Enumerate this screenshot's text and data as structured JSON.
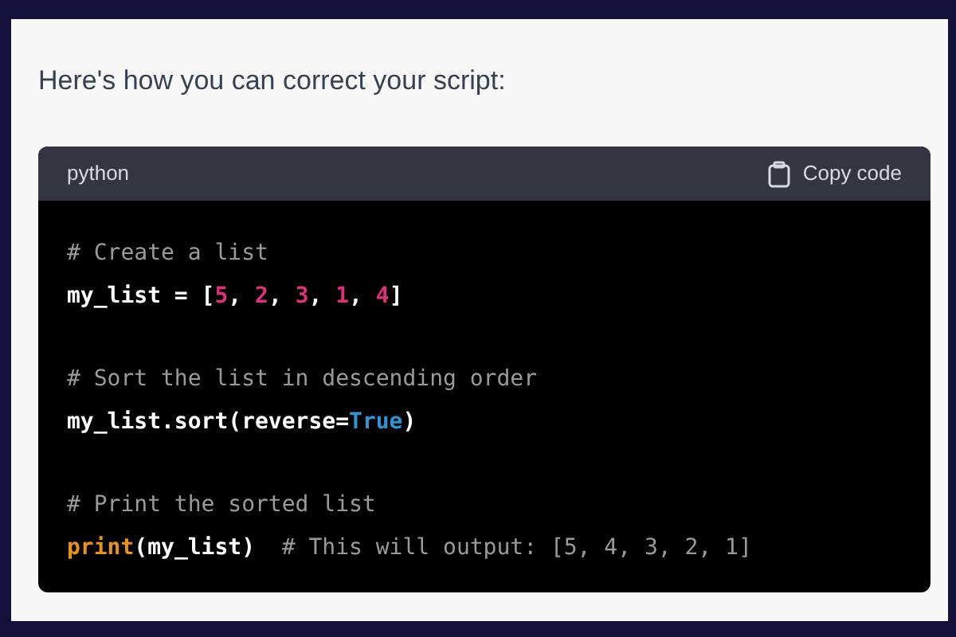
{
  "message": {
    "text": "Here's how you can correct your script:"
  },
  "code_block": {
    "language": "python",
    "copy_label": "Copy code",
    "blocks": [
      {
        "lines": [
          {
            "tokens": [
              {
                "text": "# Create a list",
                "kind": "comment"
              }
            ]
          },
          {
            "tokens": [
              {
                "text": "my_list = [",
                "kind": "plain"
              },
              {
                "text": "5",
                "kind": "number"
              },
              {
                "text": ", ",
                "kind": "plain"
              },
              {
                "text": "2",
                "kind": "number"
              },
              {
                "text": ", ",
                "kind": "plain"
              },
              {
                "text": "3",
                "kind": "number"
              },
              {
                "text": ", ",
                "kind": "plain"
              },
              {
                "text": "1",
                "kind": "number"
              },
              {
                "text": ", ",
                "kind": "plain"
              },
              {
                "text": "4",
                "kind": "number"
              },
              {
                "text": "]",
                "kind": "plain"
              }
            ]
          }
        ]
      },
      {
        "lines": [
          {
            "tokens": [
              {
                "text": "# Sort the list in descending order",
                "kind": "comment"
              }
            ]
          },
          {
            "tokens": [
              {
                "text": "my_list.sort(reverse=",
                "kind": "plain"
              },
              {
                "text": "True",
                "kind": "literal"
              },
              {
                "text": ")",
                "kind": "plain"
              }
            ]
          }
        ]
      },
      {
        "lines": [
          {
            "tokens": [
              {
                "text": "# Print the sorted list",
                "kind": "comment"
              }
            ]
          },
          {
            "tokens": [
              {
                "text": "print",
                "kind": "builtin"
              },
              {
                "text": "(my_list)  ",
                "kind": "plain"
              },
              {
                "text": "# This will output: [5, 4, 3, 2, 1]",
                "kind": "comment"
              }
            ]
          }
        ]
      }
    ]
  }
}
